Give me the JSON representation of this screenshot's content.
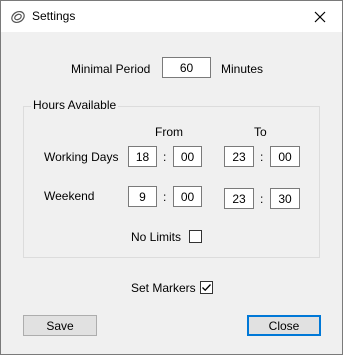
{
  "window": {
    "title": "Settings"
  },
  "period": {
    "label": "Minimal Period",
    "value": "60",
    "unit": "Minutes"
  },
  "hours": {
    "group_title": "Hours Available",
    "from_header": "From",
    "to_header": "To",
    "separator": ":",
    "working_days": {
      "label": "Working Days",
      "from_hour": "18",
      "from_minute": "00",
      "to_hour": "23",
      "to_minute": "00"
    },
    "weekend": {
      "label": "Weekend",
      "from_hour": "9",
      "from_minute": "00",
      "to_hour": "23",
      "to_minute": "30"
    },
    "no_limits": {
      "label": "No Limits",
      "checked": false
    }
  },
  "set_markers": {
    "label": "Set Markers",
    "checked": true
  },
  "buttons": {
    "save": "Save",
    "close": "Close"
  }
}
